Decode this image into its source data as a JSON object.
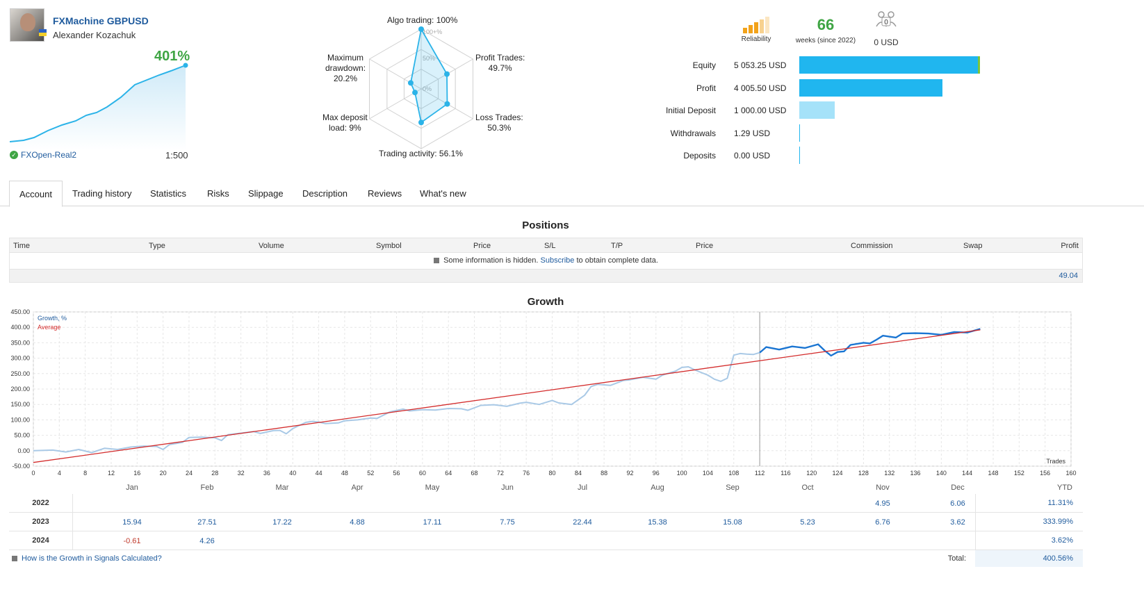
{
  "signal": {
    "title": "FXMachine GBPUSD",
    "author": "Alexander Kozachuk",
    "growth": "401%",
    "broker": "FXOpen-Real2",
    "leverage": "1:500",
    "accent": "#1f5b9d",
    "positive_color": "#3fa544"
  },
  "radar": {
    "labels": {
      "algo": "Algo trading: 100%",
      "profit": "Profit Trades:\n49.7%",
      "loss": "Loss Trades:\n50.3%",
      "activity": "Trading activity: 56.1%",
      "deposit": "Max deposit\nload: 9%",
      "drawdown": "Maximum\ndrawdown:\n20.2%"
    },
    "ring_labels": [
      "100+%",
      "50%",
      "0%"
    ],
    "values": [
      1.0,
      0.497,
      0.503,
      0.561,
      0.09,
      0.202
    ]
  },
  "stats": {
    "reliability_label": "Reliability",
    "weeks": "66",
    "weeks_label": "weeks (since 2022)",
    "subscribers_count": "0",
    "subscribers_value": "0 USD",
    "bars": [
      {
        "label": "Equity",
        "value": "5 053.25 USD",
        "amount": 5053.25,
        "color": "#20b6ef"
      },
      {
        "label": "Profit",
        "value": "4 005.50 USD",
        "amount": 4005.5,
        "color": "#20b6ef"
      },
      {
        "label": "Initial Deposit",
        "value": "1 000.00 USD",
        "amount": 1000.0,
        "color": "#a5e2f9"
      },
      {
        "label": "Withdrawals",
        "value": "1.29 USD",
        "amount": 1.29,
        "color": "#20b6ef"
      },
      {
        "label": "Deposits",
        "value": "0.00 USD",
        "amount": 0,
        "color": "#20b6ef"
      }
    ]
  },
  "tabs": [
    "Account",
    "Trading history",
    "Statistics",
    "Risks",
    "Slippage",
    "Description",
    "Reviews",
    "What's new"
  ],
  "positions": {
    "title": "Positions",
    "columns": [
      "Time",
      "Type",
      "Volume",
      "Symbol",
      "Price",
      "S/L",
      "T/P",
      "Price",
      "Commission",
      "Swap",
      "Profit"
    ],
    "info_before": "Some information is hidden.",
    "info_link": "Subscribe",
    "info_after": "to obtain complete data.",
    "footer_profit": "49.04"
  },
  "growth": {
    "title": "Growth",
    "legend_growth": "Growth, %",
    "legend_average": "Average",
    "xlabel": "Trades"
  },
  "chart_data": {
    "type": "line",
    "title": "Growth",
    "xlabel": "Trades",
    "ylabel": "",
    "xlim": [
      0,
      160
    ],
    "ylim": [
      -50,
      450
    ],
    "x_ticks": [
      0,
      4,
      8,
      12,
      16,
      20,
      24,
      28,
      32,
      36,
      40,
      44,
      48,
      52,
      56,
      60,
      64,
      68,
      72,
      76,
      80,
      84,
      88,
      92,
      96,
      100,
      104,
      108,
      112,
      116,
      120,
      124,
      128,
      132,
      136,
      140,
      144,
      148,
      152,
      156,
      160
    ],
    "y_ticks": [
      "450.00",
      "400.00",
      "350.00",
      "300.00",
      "250.00",
      "200.00",
      "150.00",
      "100.00",
      "50.00",
      "0.00",
      "-50.00"
    ],
    "grid": true,
    "legend": "top-left",
    "series": [
      {
        "name": "Growth, %",
        "color": "#a9c9e6",
        "x": [
          0,
          3,
          5,
          7,
          9,
          11,
          13,
          15,
          17,
          19,
          20,
          21,
          23,
          24,
          26,
          28,
          29,
          30,
          32,
          34,
          35,
          37,
          38,
          39,
          40,
          42,
          43,
          44,
          45,
          47,
          48,
          50,
          52,
          53,
          55,
          57,
          58,
          60,
          62,
          64,
          66,
          67,
          69,
          71,
          73,
          75,
          76,
          78,
          80,
          81,
          83,
          85,
          86,
          87,
          89,
          91,
          92,
          94,
          96,
          97,
          99,
          100,
          101,
          102,
          104,
          105,
          106,
          107,
          108,
          109,
          110,
          111,
          112
        ],
        "y": [
          0,
          2,
          -4,
          4,
          -6,
          8,
          4,
          12,
          15,
          14,
          4,
          20,
          27,
          43,
          44,
          42,
          33,
          52,
          57,
          62,
          56,
          65,
          66,
          55,
          72,
          92,
          95,
          93,
          88,
          90,
          97,
          100,
          106,
          105,
          126,
          135,
          129,
          133,
          132,
          137,
          136,
          131,
          147,
          149,
          144,
          154,
          157,
          150,
          163,
          155,
          150,
          180,
          208,
          215,
          212,
          228,
          230,
          238,
          232,
          245,
          258,
          270,
          272,
          262,
          245,
          232,
          225,
          235,
          310,
          315,
          313,
          312,
          318
        ]
      },
      {
        "name": "",
        "color": "#1a75d2",
        "x": [
          112,
          113,
          115,
          117,
          119,
          121,
          122,
          123,
          124,
          125,
          126,
          128,
          129,
          130,
          131,
          133,
          134,
          136,
          138,
          140,
          142,
          144,
          146
        ],
        "y": [
          318,
          336,
          328,
          338,
          333,
          345,
          325,
          308,
          320,
          322,
          343,
          350,
          348,
          360,
          373,
          367,
          380,
          381,
          380,
          376,
          385,
          383,
          395
        ]
      },
      {
        "name": "Average",
        "color": "#d32b2b",
        "x": [
          0,
          146
        ],
        "y": [
          -38,
          392
        ]
      }
    ]
  },
  "monthly": {
    "months": [
      "Jan",
      "Feb",
      "Mar",
      "Apr",
      "May",
      "Jun",
      "Jul",
      "Aug",
      "Sep",
      "Oct",
      "Nov",
      "Dec"
    ],
    "ytd_label": "YTD",
    "rows": [
      {
        "year": "2022",
        "values": [
          "",
          "",
          "",
          "",
          "",
          "",
          "",
          "",
          "",
          "",
          "4.95",
          "6.06"
        ],
        "ytd": "11.31%"
      },
      {
        "year": "2023",
        "values": [
          "15.94",
          "27.51",
          "17.22",
          "4.88",
          "17.11",
          "7.75",
          "22.44",
          "15.38",
          "15.08",
          "5.23",
          "6.76",
          "3.62"
        ],
        "ytd": "333.99%"
      },
      {
        "year": "2024",
        "values": [
          "-0.61",
          "4.26",
          "",
          "",
          "",
          "",
          "",
          "",
          "",
          "",
          "",
          ""
        ],
        "ytd": "3.62%"
      }
    ],
    "help_link": "How is the Growth in Signals Calculated?",
    "total_label": "Total:",
    "total": "400.56%"
  }
}
